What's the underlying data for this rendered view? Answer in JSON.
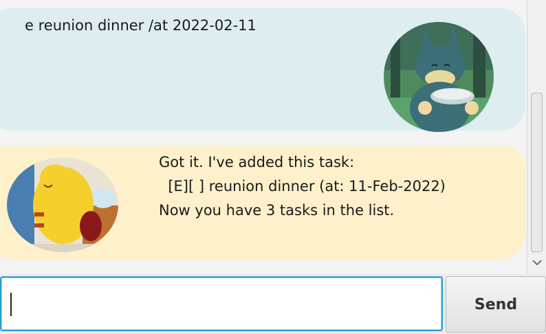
{
  "chat": {
    "user_message": "e reunion dinner /at 2022-02-11",
    "bot_lines": [
      "Got it. I've added this task:",
      "  [E][ ] reunion dinner (at: 11-Feb-2022)",
      "Now you have 3 tasks in the list."
    ],
    "user_avatar": "munchax-avatar",
    "bot_avatar": "pikachu-avatar"
  },
  "input": {
    "value": "",
    "placeholder": ""
  },
  "send": {
    "label": "Send"
  },
  "colors": {
    "user_bubble": "#ddedf0",
    "bot_bubble": "#fdf0cb",
    "input_border": "#2d9bd8"
  }
}
